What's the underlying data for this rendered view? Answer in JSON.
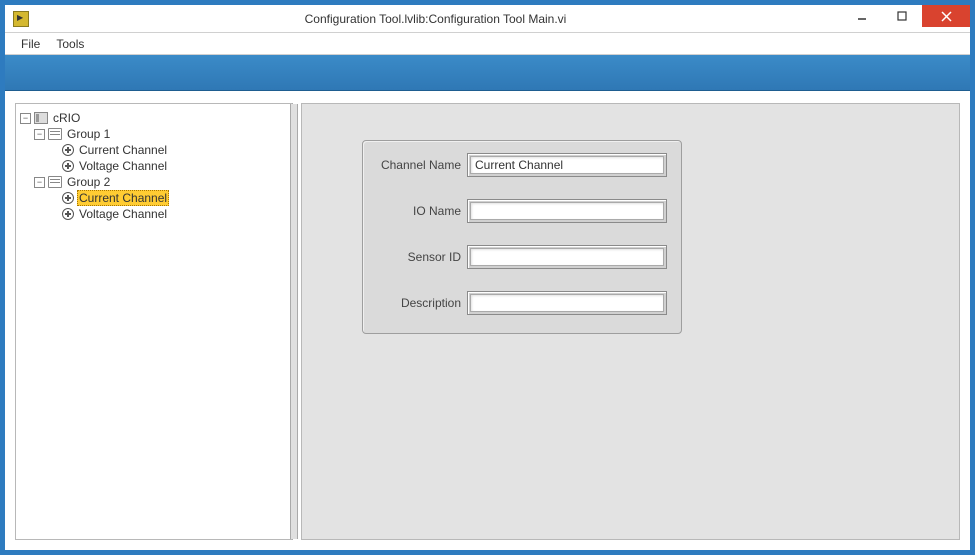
{
  "window": {
    "title": "Configuration Tool.lvlib:Configuration Tool Main.vi"
  },
  "menu": {
    "file": "File",
    "tools": "Tools"
  },
  "tree": {
    "root": {
      "label": "cRIO",
      "expanded": true,
      "expander": "−"
    },
    "group1": {
      "label": "Group 1",
      "expanded": true,
      "expander": "−",
      "child1": "Current Channel",
      "child2": "Voltage Channel"
    },
    "group2": {
      "label": "Group 2",
      "expanded": true,
      "expander": "−",
      "child1": "Current Channel",
      "child2": "Voltage Channel"
    }
  },
  "form": {
    "channel_name": {
      "label": "Channel Name",
      "value": "Current Channel"
    },
    "io_name": {
      "label": "IO Name",
      "value": ""
    },
    "sensor_id": {
      "label": "Sensor ID",
      "value": ""
    },
    "description": {
      "label": "Description",
      "value": ""
    }
  }
}
